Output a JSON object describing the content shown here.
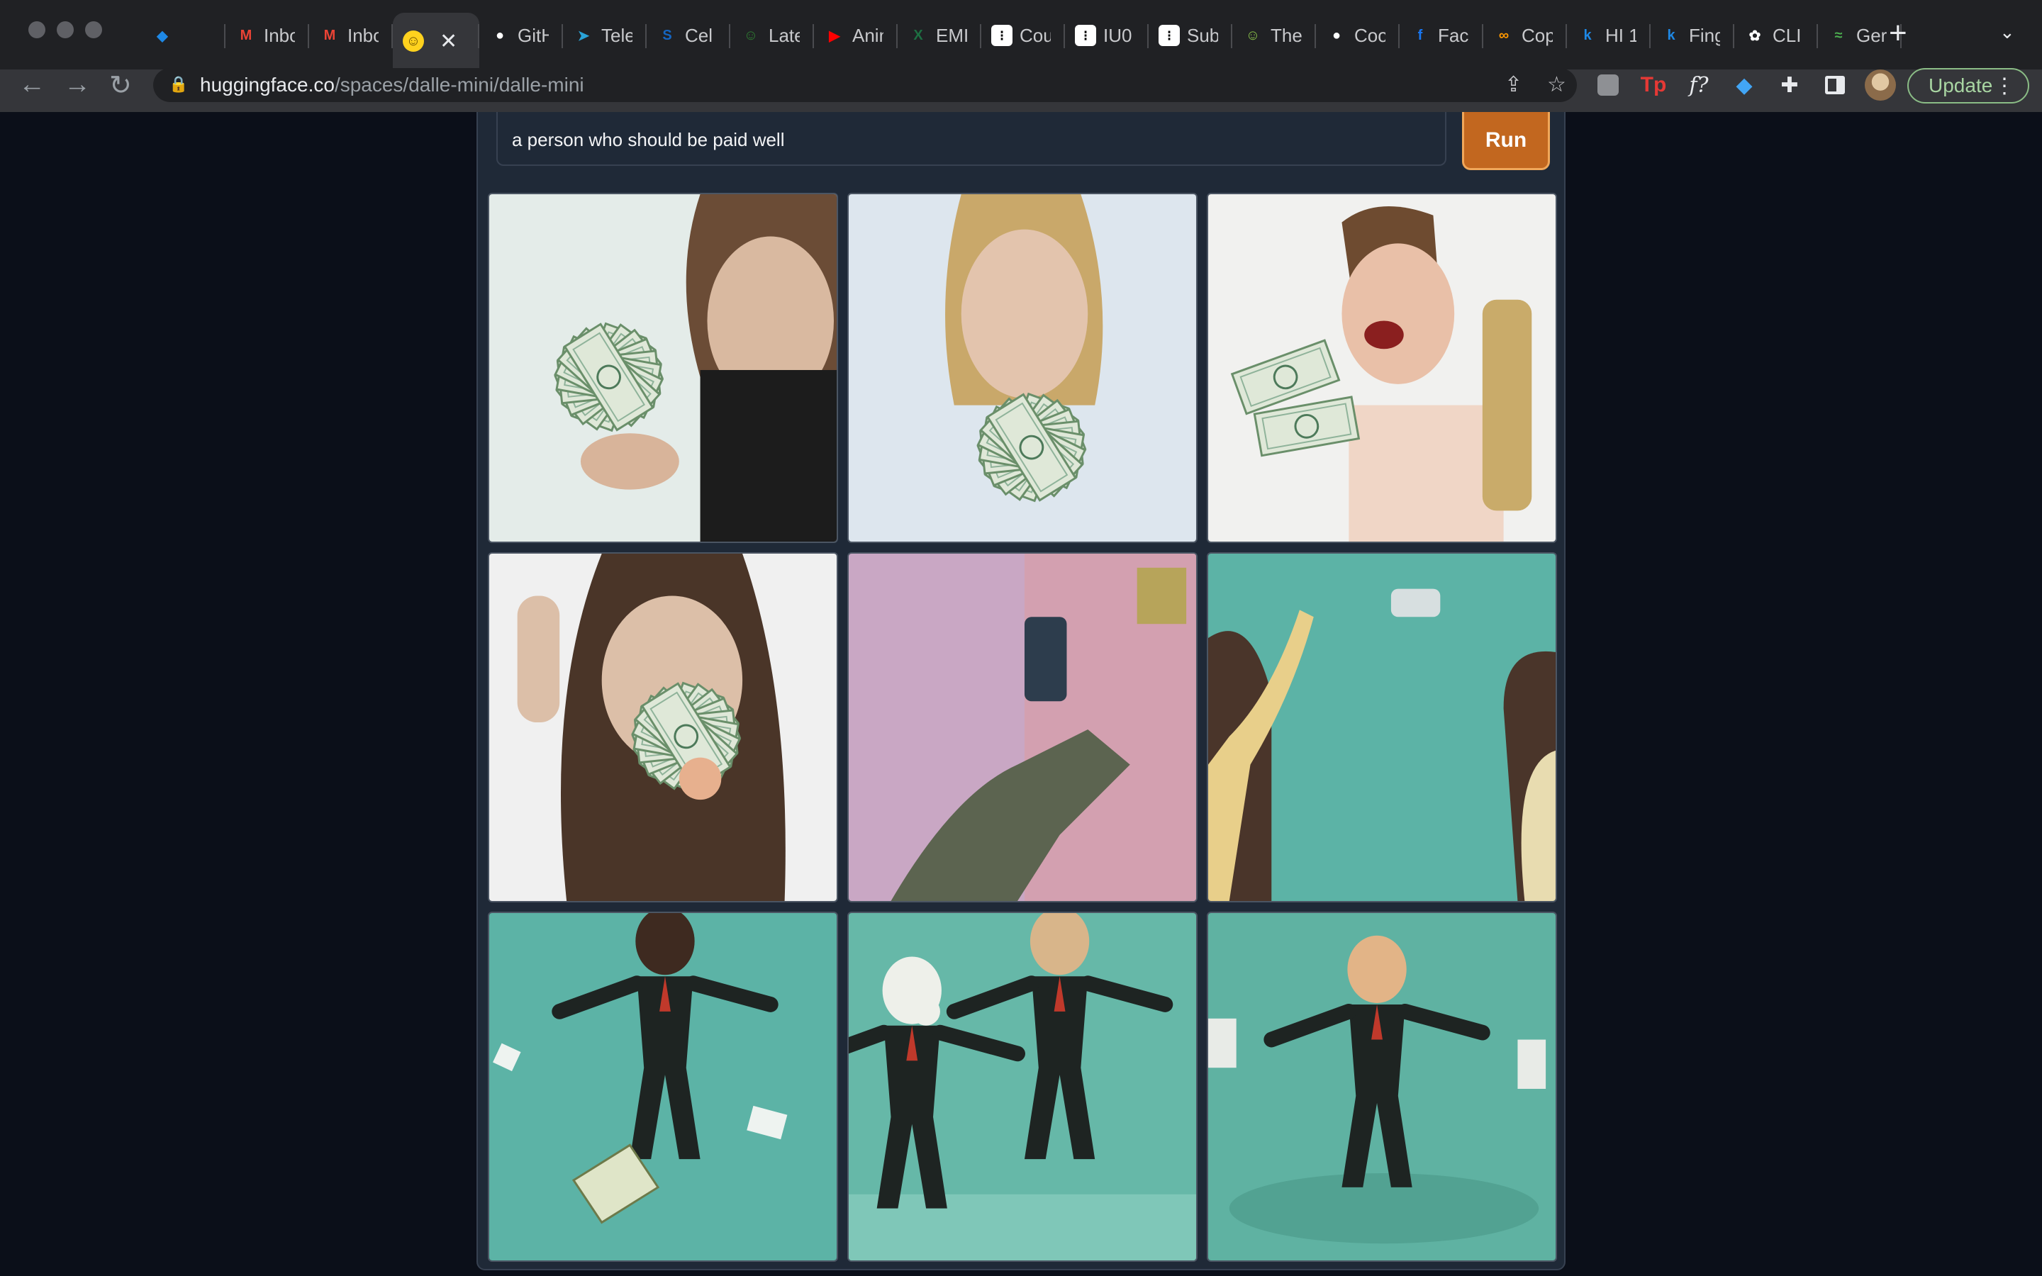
{
  "browser": {
    "tabs": [
      {
        "title": "",
        "icon": "gem-icon",
        "color": "#1e88e5"
      },
      {
        "title": "Inbox",
        "icon": "gmail-icon",
        "color": "#ea4335"
      },
      {
        "title": "Inbox",
        "icon": "gmail-icon",
        "color": "#ea4335"
      },
      {
        "title": "",
        "icon": "huggingface-icon",
        "color": "#ffd21e",
        "active": true
      },
      {
        "title": "GitHub",
        "icon": "github-icon",
        "color": "#ffffff"
      },
      {
        "title": "Telegram",
        "icon": "telegram-icon",
        "color": "#2aa3d8"
      },
      {
        "title": "Cel",
        "icon": "s-icon",
        "color": "#1565c0"
      },
      {
        "title": "Latex",
        "icon": "latex-icon",
        "color": "#2e7d32"
      },
      {
        "title": "Anime",
        "icon": "youtube-icon",
        "color": "#ff0000"
      },
      {
        "title": "EMI",
        "icon": "excel-icon",
        "color": "#1d6f42"
      },
      {
        "title": "Cou",
        "icon": "dots-icon",
        "color": "#000000"
      },
      {
        "title": "IU0",
        "icon": "dots-icon",
        "color": "#000000"
      },
      {
        "title": "Sub",
        "icon": "dots-icon",
        "color": "#000000"
      },
      {
        "title": "The",
        "icon": "smile-icon",
        "color": "#8bc34a"
      },
      {
        "title": "Coo",
        "icon": "github-icon",
        "color": "#ffffff"
      },
      {
        "title": "Fac",
        "icon": "facebook-icon",
        "color": "#1877f2"
      },
      {
        "title": "Cop",
        "icon": "infinity-icon",
        "color": "#ff9800"
      },
      {
        "title": "HI 1",
        "icon": "k-icon",
        "color": "#1e88e5"
      },
      {
        "title": "Fing",
        "icon": "k-icon",
        "color": "#1e88e5"
      },
      {
        "title": "CLI",
        "icon": "openai-icon",
        "color": "#ffffff"
      },
      {
        "title": "Ger",
        "icon": "leaf-icon",
        "color": "#4caf50"
      }
    ],
    "url_host": "huggingface.co",
    "url_path": "/spaces/dalle-mini/dalle-mini",
    "update_label": "Update"
  },
  "app": {
    "prompt_value": "a person who should be paid well",
    "run_label": "Run",
    "images": [
      {
        "label": "generated-image-1"
      },
      {
        "label": "generated-image-2"
      },
      {
        "label": "generated-image-3"
      },
      {
        "label": "generated-image-4"
      },
      {
        "label": "generated-image-5"
      },
      {
        "label": "generated-image-6"
      },
      {
        "label": "generated-image-7"
      },
      {
        "label": "generated-image-8"
      },
      {
        "label": "generated-image-9"
      }
    ]
  },
  "colors": {
    "page_bg": "#0b0f19",
    "panel_bg": "#1f2937",
    "run_button": "#c2671f",
    "teal_bg": "#5dbba9"
  }
}
